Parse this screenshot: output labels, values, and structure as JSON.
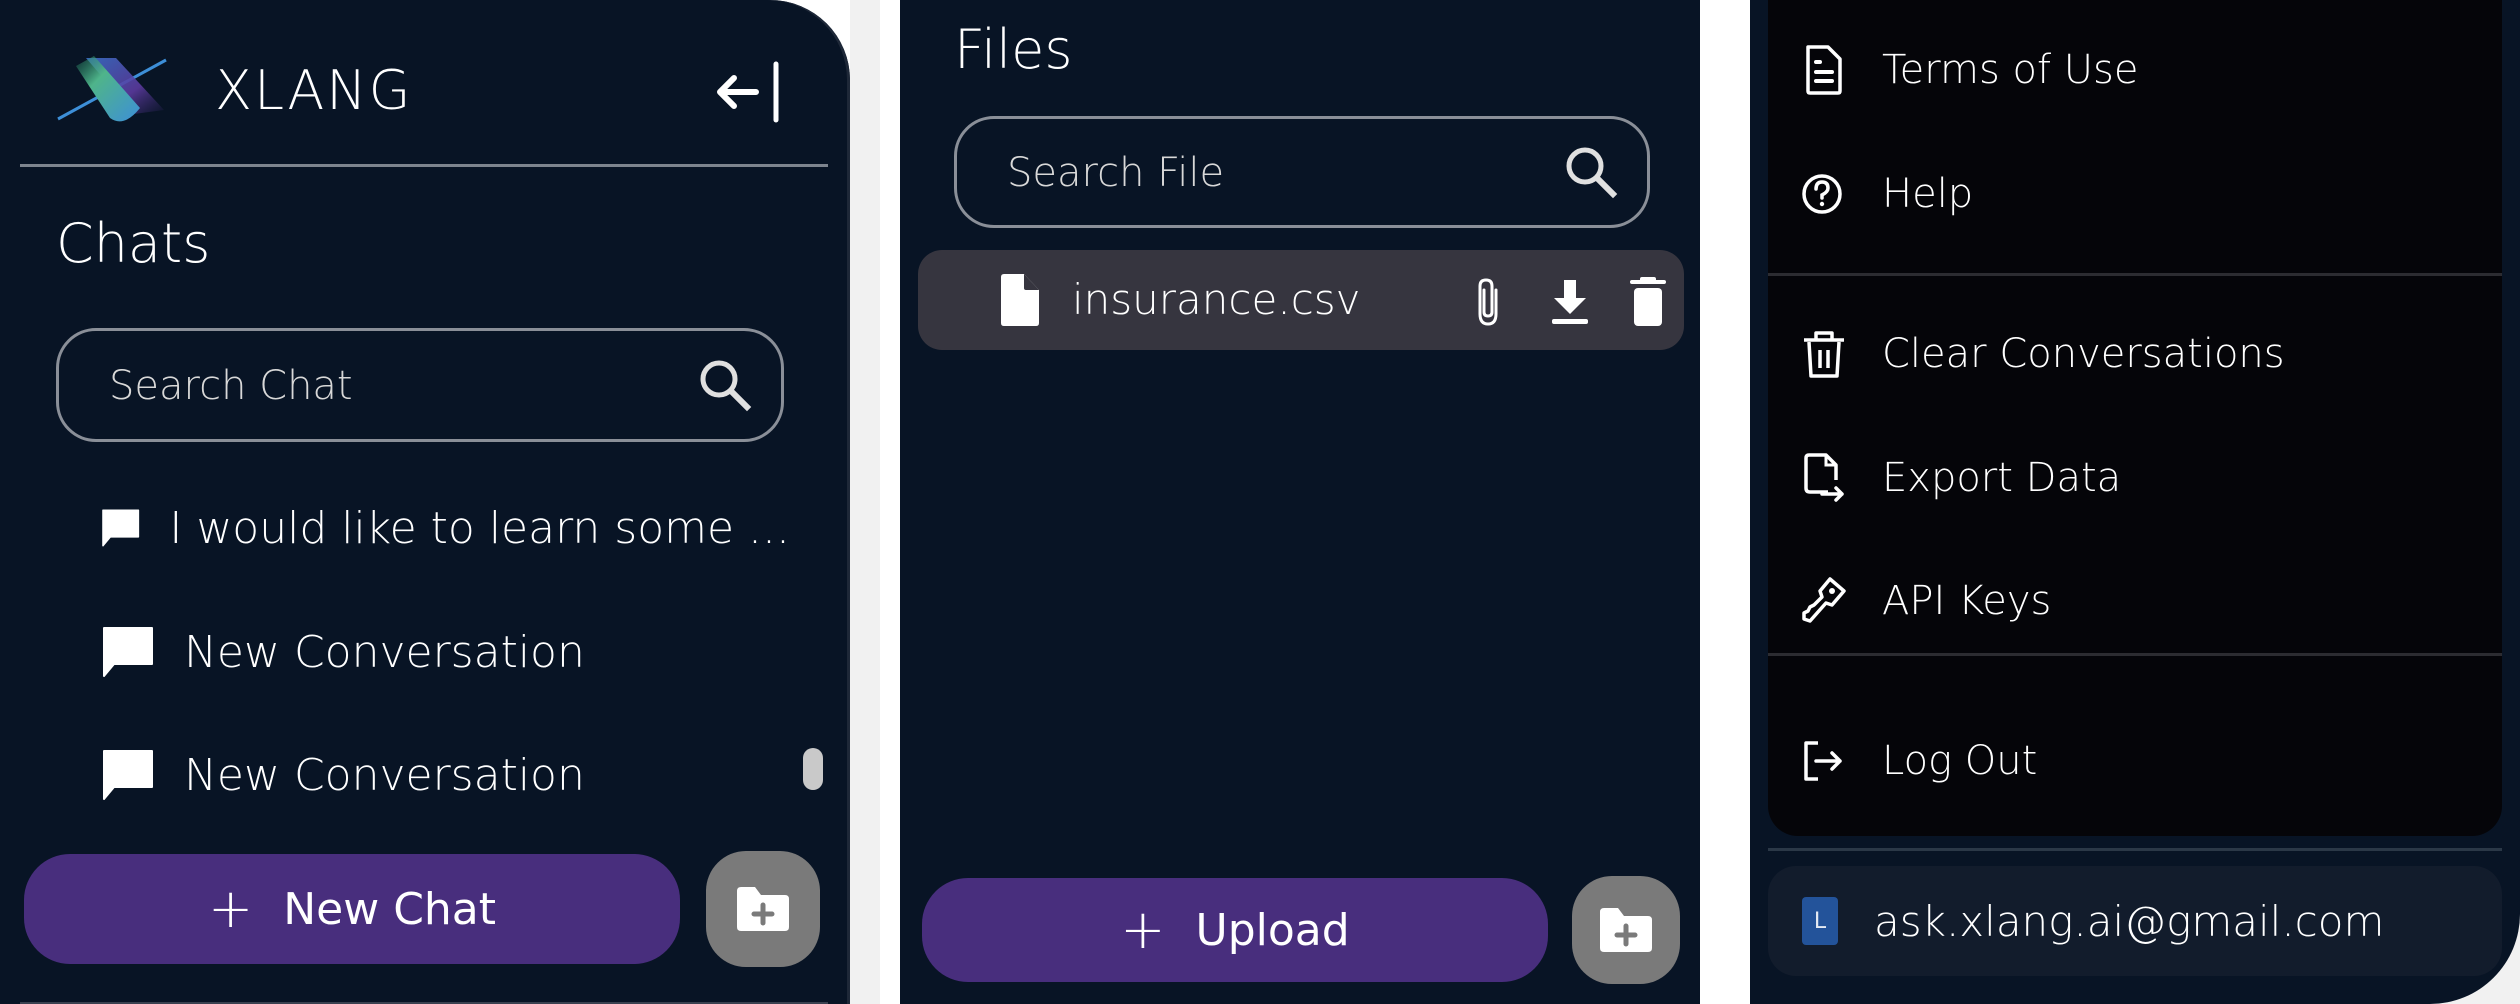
{
  "sidebar": {
    "brand": "XLANG",
    "section_title": "Chats",
    "search": {
      "placeholder": "Search Chat",
      "value": ""
    },
    "chats": [
      {
        "title": "I would like to learn some ...",
        "icon": "chat-bubble-icon"
      },
      {
        "title": "New Conversation",
        "icon": "chat-bubble-icon"
      },
      {
        "title": "New Conversation",
        "icon": "chat-bubble-icon"
      }
    ],
    "new_chat_label": "New Chat",
    "new_folder_icon": "folder-plus-icon",
    "collapse_icon": "arrow-left-to-line-icon"
  },
  "files": {
    "section_title": "Files",
    "search": {
      "placeholder": "Search File",
      "value": ""
    },
    "items": [
      {
        "name": "insurance.csv",
        "icon": "file-icon",
        "actions": [
          "attach",
          "download",
          "delete"
        ]
      }
    ],
    "upload_label": "Upload",
    "new_folder_icon": "folder-plus-icon"
  },
  "settings_menu": {
    "groups": [
      [
        {
          "label": "Terms of Use",
          "icon": "document-icon"
        },
        {
          "label": "Help",
          "icon": "help-circle-icon"
        }
      ],
      [
        {
          "label": "Clear Conversations",
          "icon": "trash-icon"
        },
        {
          "label": "Export Data",
          "icon": "file-export-icon"
        },
        {
          "label": "API Keys",
          "icon": "key-icon"
        }
      ],
      [
        {
          "label": "Log Out",
          "icon": "logout-icon"
        }
      ]
    ],
    "account": {
      "avatar_initial": "L",
      "email": "ask.xlang.ai@gmail.com"
    }
  },
  "colors": {
    "background": "#081425",
    "primary_button": "#482e7d",
    "folder_button": "#7a7a7a",
    "file_row": "#36353f",
    "menu_background": "#050509",
    "account_card": "#121c2c",
    "avatar": "#23539a"
  }
}
